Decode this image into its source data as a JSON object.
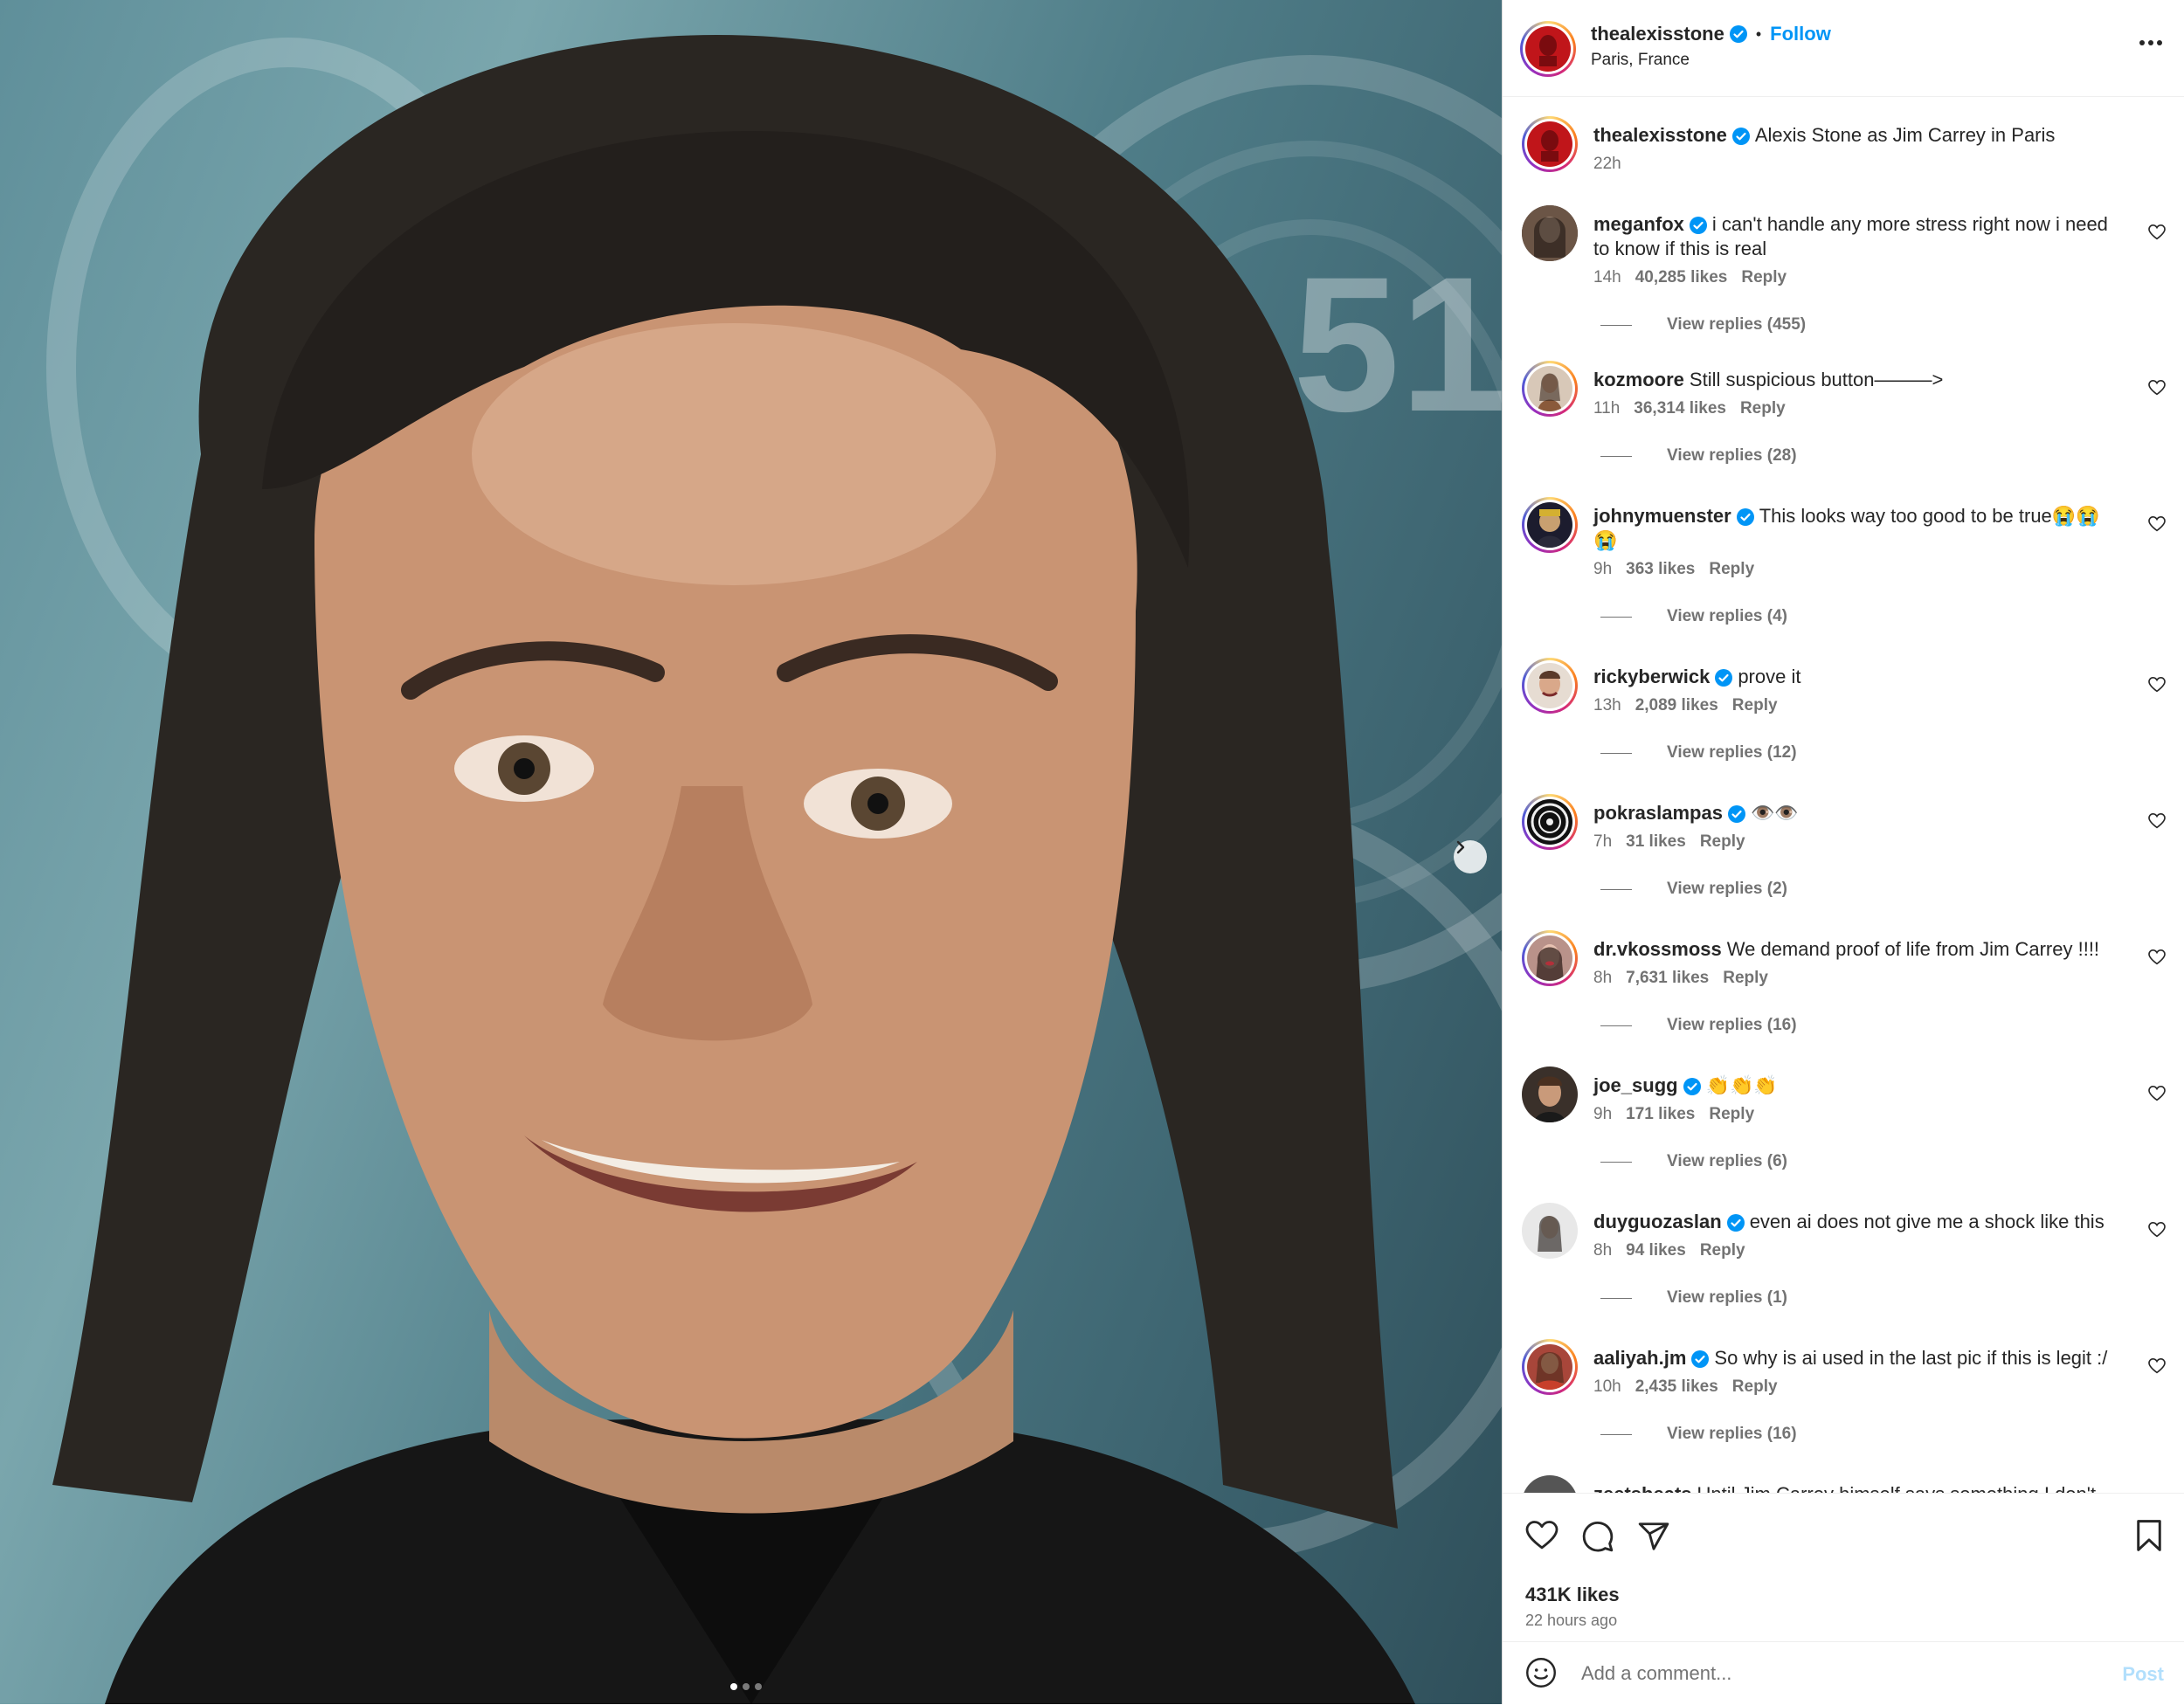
{
  "header": {
    "username": "thealexisstone",
    "separator": "•",
    "follow_label": "Follow",
    "location": "Paris, France",
    "more_icon": "more-horizontal-icon"
  },
  "caption": {
    "username": "thealexisstone",
    "text": "Alexis Stone as Jim Carrey in Paris",
    "time": "22h"
  },
  "comments": [
    {
      "username": "meganfox",
      "text": "i can't handle any more stress right now i need to know if this is real",
      "time": "14h",
      "likes": "40,285 likes",
      "reply": "Reply",
      "view_replies": "View replies (455)"
    },
    {
      "username": "kozmoore",
      "text": "Still suspicious button———>",
      "time": "11h",
      "likes": "36,314 likes",
      "reply": "Reply",
      "view_replies": "View replies (28)"
    },
    {
      "username": "johnymuenster",
      "text": "This looks way too good to be true😭😭😭",
      "time": "9h",
      "likes": "363 likes",
      "reply": "Reply",
      "view_replies": "View replies (4)"
    },
    {
      "username": "rickyberwick",
      "text": "prove it",
      "time": "13h",
      "likes": "2,089 likes",
      "reply": "Reply",
      "view_replies": "View replies (12)"
    },
    {
      "username": "pokraslampas",
      "text": "👁️👁️",
      "time": "7h",
      "likes": "31 likes",
      "reply": "Reply",
      "view_replies": "View replies (2)"
    },
    {
      "username": "dr.vkossmoss",
      "text": "We demand proof of life from Jim Carrey !!!!",
      "time": "8h",
      "likes": "7,631 likes",
      "reply": "Reply",
      "view_replies": "View replies (16)"
    },
    {
      "username": "joe_sugg",
      "text": "👏👏👏",
      "time": "9h",
      "likes": "171 likes",
      "reply": "Reply",
      "view_replies": "View replies (6)"
    },
    {
      "username": "duyguozaslan",
      "text": "even ai does not give me a shock like this",
      "time": "8h",
      "likes": "94 likes",
      "reply": "Reply",
      "view_replies": "View replies (1)"
    },
    {
      "username": "aaliyah.jm",
      "text": "So why is ai used in the last pic if this is legit :/",
      "time": "10h",
      "likes": "2,435 likes",
      "reply": "Reply",
      "view_replies": "View replies (16)"
    },
    {
      "username": "zeetsbeats",
      "text": "Until Jim Carrey himself says something I don't"
    }
  ],
  "footer": {
    "likes": "431K likes",
    "time_ago": "22 hours ago"
  },
  "composer": {
    "placeholder": "Add a comment...",
    "post_label": "Post"
  },
  "media": {
    "carousel_count": 3,
    "carousel_active": 1
  },
  "colors": {
    "accent": "#0095f6",
    "post_disabled": "#b2dffc",
    "verified": "#0095f6",
    "secondary_text": "#737373"
  }
}
